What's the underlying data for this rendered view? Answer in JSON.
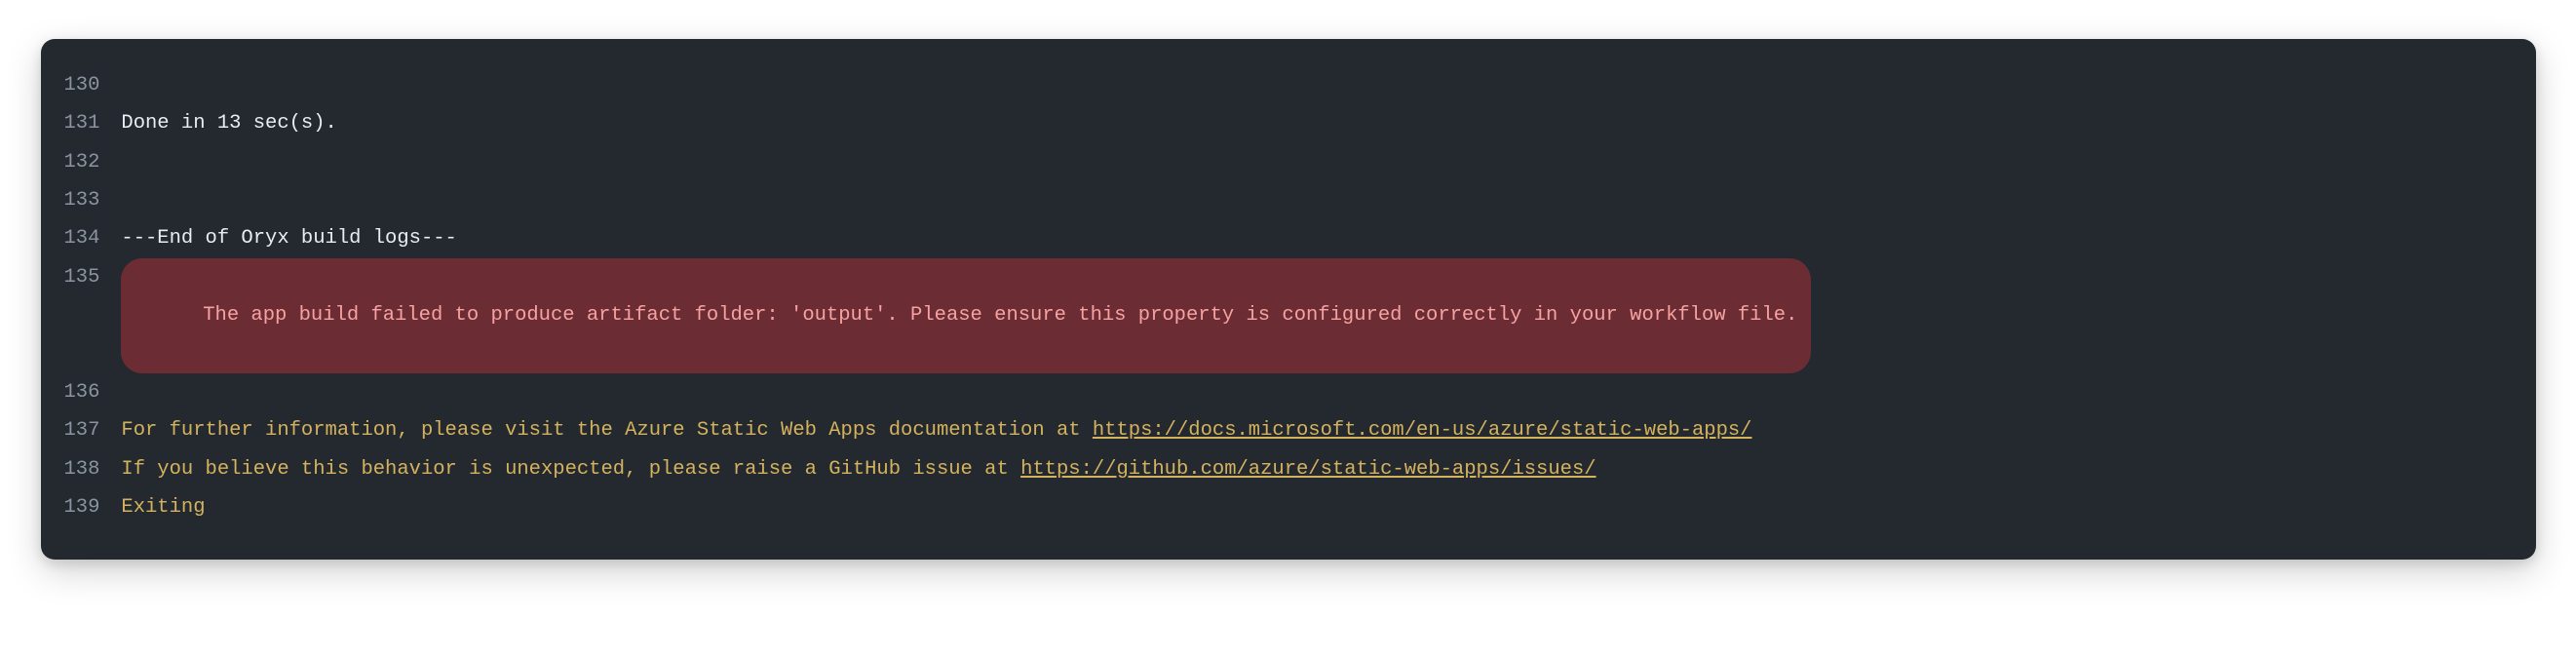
{
  "log": {
    "lines": [
      {
        "n": "130",
        "kind": "plain",
        "text": ""
      },
      {
        "n": "131",
        "kind": "plain",
        "text": "Done in 13 sec(s)."
      },
      {
        "n": "132",
        "kind": "plain",
        "text": ""
      },
      {
        "n": "133",
        "kind": "plain",
        "text": ""
      },
      {
        "n": "134",
        "kind": "plain",
        "text": "---End of Oryx build logs---"
      },
      {
        "n": "135",
        "kind": "error",
        "text": "The app build failed to produce artifact folder: 'output'. Please ensure this property is configured correctly in your workflow file."
      },
      {
        "n": "136",
        "kind": "plain",
        "text": ""
      },
      {
        "n": "137",
        "kind": "info-link",
        "prefix": "For further information, please visit the Azure Static Web Apps documentation at ",
        "link": "https://docs.microsoft.com/en-us/azure/static-web-apps/"
      },
      {
        "n": "138",
        "kind": "info-link",
        "prefix": "If you believe this behavior is unexpected, please raise a GitHub issue at ",
        "link": "https://github.com/azure/static-web-apps/issues/"
      },
      {
        "n": "139",
        "kind": "info",
        "text": "Exiting"
      }
    ]
  }
}
